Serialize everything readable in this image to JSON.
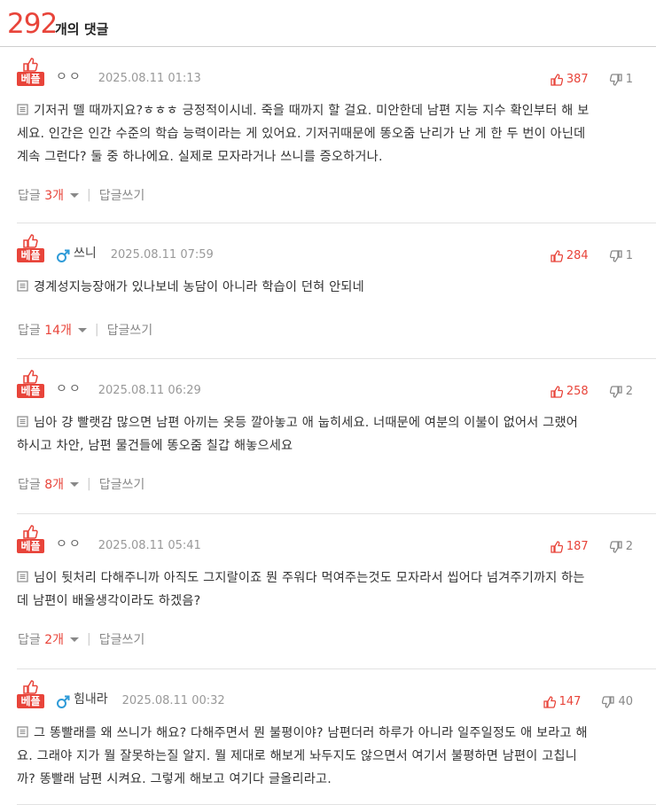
{
  "header": {
    "count": "292",
    "label": "개의 댓글"
  },
  "comments": [
    {
      "badge": "베플",
      "user": "ㅇㅇ",
      "gender": "none",
      "date": "2025.08.11 01:13",
      "up": "387",
      "down": "1",
      "lines": [
        "기저귀 뗄 때까지요?ㅎㅎㅎ 긍정적이시네. 죽을 때까지 할 걸요. 미안한데 남편 지능 지수 확인부터 해 보",
        "세요. 인간은 인간 수준의 학습 능력이라는 게 있어요. 기저귀때문에 똥오줌 난리가 난 게 한 두 번이 아닌데",
        "계속 그런다? 둘 중 하나에요. 실제로 모자라거나 쓰니를 증오하거나."
      ],
      "reply_label": "답글",
      "reply_count": "3개",
      "write_label": "답글쓰기"
    },
    {
      "badge": "베플",
      "user": "쓰니",
      "gender": "male",
      "date": "2025.08.11 07:59",
      "up": "284",
      "down": "1",
      "lines": [
        "경계성지능장애가 있나보네 농담이 아니라 학습이 던혀 안되네"
      ],
      "reply_label": "답글",
      "reply_count": "14개",
      "write_label": "답글쓰기"
    },
    {
      "badge": "베플",
      "user": "ㅇㅇ",
      "gender": "none",
      "date": "2025.08.11 06:29",
      "up": "258",
      "down": "2",
      "lines": [
        "님아 걍 빨랫감 많으면 남편 아끼는 옷등 깔아놓고 애 눕히세요. 너때문에 여분의 이불이 없어서 그랬어",
        "하시고 차안, 남편 물건들에 똥오줌 칠갑 해놓으세요"
      ],
      "reply_label": "답글",
      "reply_count": "8개",
      "write_label": "답글쓰기"
    },
    {
      "badge": "베플",
      "user": "ㅇㅇ",
      "gender": "none",
      "date": "2025.08.11 05:41",
      "up": "187",
      "down": "2",
      "lines": [
        "님이 뒷처리 다해주니까 아직도 그지랄이죠 뭔 주워다 먹여주는것도 모자라서 씹어다 넘겨주기까지 하는",
        "데 남편이 배울생각이라도 하겠음?"
      ],
      "reply_label": "답글",
      "reply_count": "2개",
      "write_label": "답글쓰기"
    },
    {
      "badge": "베플",
      "user": "힘내라",
      "gender": "male",
      "date": "2025.08.11 00:32",
      "up": "147",
      "down": "40",
      "lines": [
        "그 똥빨래를 왜 쓰니가 해요? 다해주면서 뭔 불평이야? 남편더러 하루가 아니라 일주일정도 애 보라고 해",
        "요. 그래야 지가 뭘 잘못하는질 알지. 뭘 제대로 해보게 놔두지도 않으면서 여기서 불평하면 남편이 고칩니",
        "까? 똥빨래 남편 시켜요. 그렇게 해보고 여기다 글올리라고."
      ],
      "reply_label": "",
      "reply_count": "",
      "write_label": ""
    }
  ],
  "colors": {
    "accent": "#e8443a",
    "male": "#2f9bd8",
    "muted": "#888888"
  },
  "icons": {
    "best": "thumbs-up-icon",
    "up": "thumbs-up-icon",
    "down": "thumbs-down-icon",
    "doc": "document-icon",
    "male": "male-icon"
  }
}
